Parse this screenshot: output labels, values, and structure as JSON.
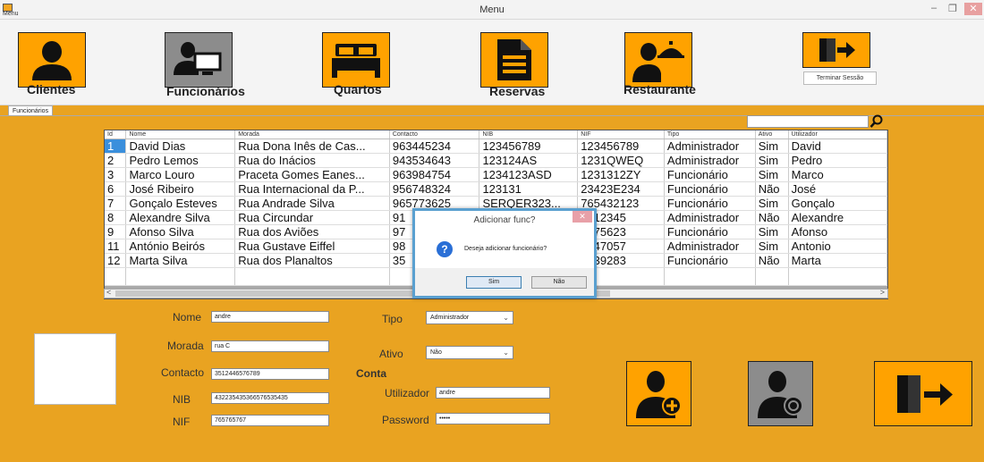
{
  "window": {
    "title": "Menu",
    "menu_label": "Menu",
    "minimize": "–",
    "maximize": "❐",
    "close": "✕"
  },
  "toolbar": {
    "items": [
      {
        "label": "Clientes",
        "icon": "person-icon"
      },
      {
        "label": "Funcionários",
        "icon": "employee-computer-icon"
      },
      {
        "label": "Quartos",
        "icon": "bed-icon"
      },
      {
        "label": "Reservas",
        "icon": "document-icon"
      },
      {
        "label": "Restaurante",
        "icon": "waiter-icon"
      }
    ],
    "logout_label": "Terminar Sessão"
  },
  "tab": {
    "label": "Funcionários"
  },
  "search": {
    "value": ""
  },
  "grid": {
    "columns": [
      "Id",
      "Nome",
      "Morada",
      "Contacto",
      "NIB",
      "NIF",
      "Tipo",
      "Ativo",
      "Utilizador"
    ],
    "rows": [
      [
        "1",
        "David Dias",
        "Rua Dona Inês de Cas...",
        "963445234",
        "123456789",
        "123456789",
        "Administrador",
        "Sim",
        "David"
      ],
      [
        "2",
        "Pedro Lemos",
        "Rua do Inácios",
        "943534643",
        "123124AS",
        "1231QWEQ",
        "Administrador",
        "Sim",
        "Pedro"
      ],
      [
        "3",
        "Marco Louro",
        "Praceta Gomes Eanes...",
        "963984754",
        "1234123ASD",
        "1231312ZY",
        "Funcionário",
        "Sim",
        "Marco"
      ],
      [
        "6",
        "José Ribeiro",
        "Rua Internacional da P...",
        "956748324",
        "123131",
        "23423E234",
        "Funcionário",
        "Não",
        "José"
      ],
      [
        "7",
        "Gonçalo Esteves",
        "Rua Andrade Silva",
        "965773625",
        "SERQER323...",
        "765432123",
        "Funcionário",
        "Sim",
        "Gonçalo"
      ],
      [
        "8",
        "Alexandre Silva",
        "Rua Circundar",
        "91",
        "",
        "3212345",
        "Administrador",
        "Não",
        "Alexandre"
      ],
      [
        "9",
        "Afonso Silva",
        "Rua dos Aviões",
        "97",
        "",
        "8475623",
        "Funcionário",
        "Sim",
        "Afonso"
      ],
      [
        "11",
        "António Beirós",
        "Rua Gustave Eiffel",
        "98",
        "",
        "3847057",
        "Administrador",
        "Sim",
        "Antonio"
      ],
      [
        "12",
        "Marta Silva",
        "Rua dos Planaltos",
        "35",
        "",
        "2839283",
        "Funcionário",
        "Não",
        "Marta"
      ]
    ],
    "scroll_left": "<",
    "scroll_right": ">"
  },
  "dialog": {
    "title": "Adicionar func?",
    "message": "Deseja adicionar funcionário?",
    "icon_glyph": "?",
    "yes": "Sim",
    "no": "Não",
    "close": "✕"
  },
  "form": {
    "nome_label": "Nome",
    "nome_value": "andre",
    "morada_label": "Morada",
    "morada_value": "rua C",
    "contacto_label": "Contacto",
    "contacto_value": "3512446576789",
    "nib_label": "NIB",
    "nib_value": "43223543536657653543​5",
    "nif_label": "NIF",
    "nif_value": "765765767",
    "tipo_label": "Tipo",
    "tipo_value": "Administrador",
    "ativo_label": "Ativo",
    "ativo_value": "Não",
    "conta_label": "Conta",
    "utilizador_label": "Utilizador",
    "utilizador_value": "andre",
    "password_label": "Password",
    "password_value": "•••••"
  },
  "colors": {
    "background": "#e9a321",
    "button_orange": "#ffa200",
    "button_gray": "#8c8c8c",
    "selection": "#3a8fdc"
  }
}
